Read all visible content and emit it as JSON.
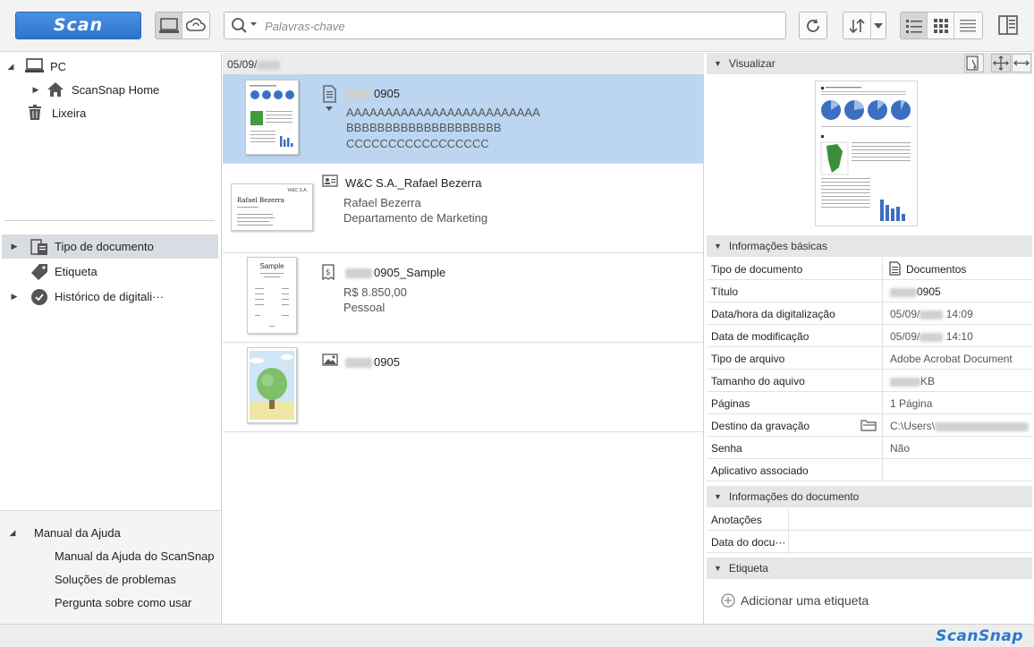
{
  "toolbar": {
    "scan_label": "Scan",
    "search_placeholder": "Palavras-chave",
    "icons": [
      "computer-icon",
      "cloud-sync-icon",
      "search-icon",
      "refresh-icon",
      "sort-icon",
      "list-view-icon",
      "grid-view-icon",
      "detail-view-icon",
      "panel-toggle-icon"
    ]
  },
  "sidebar": {
    "tree": {
      "pc": "PC",
      "home": "ScanSnap Home",
      "trash": "Lixeira"
    },
    "categories": [
      {
        "label": "Tipo de documento"
      },
      {
        "label": "Etiqueta"
      },
      {
        "label": "Histórico de digitali···"
      }
    ],
    "help": {
      "title": "Manual da Ajuda",
      "items": [
        "Manual da Ajuda do ScanSnap",
        "Soluções de problemas",
        "Pergunta sobre como usar"
      ]
    }
  },
  "list": {
    "date_header": "05/09/",
    "items": [
      {
        "name": "0905",
        "lines": [
          "AAAAAAAAAAAAAAAAAAAAAAAAA",
          "BBBBBBBBBBBBBBBBBBBB",
          "CCCCCCCCCCCCCCCCC"
        ]
      },
      {
        "name": "W&C S.A._Rafael Bezerra",
        "lines": [
          "Rafael Bezerra",
          "Departamento de Marketing"
        ],
        "card_title": "Rafael Bezerra",
        "card_corner": "W&C S.A."
      },
      {
        "name": "0905_Sample",
        "lines": [
          "R$ 8.850,00",
          "Pessoal"
        ],
        "receipt_title": "Sample"
      },
      {
        "name": "0905",
        "lines": []
      }
    ]
  },
  "details": {
    "preview_title": "Visualizar",
    "basic_title": "Informações básicas",
    "basic": [
      {
        "key": "Tipo de documento",
        "value": "Documentos"
      },
      {
        "key": "Título",
        "value": "0905"
      },
      {
        "key": "Data/hora da digitalização",
        "value_pre": "05/09/",
        "value_post": "14:09"
      },
      {
        "key": "Data de modificação",
        "value_pre": "05/09/",
        "value_post": "14:10"
      },
      {
        "key": "Tipo de arquivo",
        "value": "Adobe Acrobat Document"
      },
      {
        "key": "Tamanho do aquivo",
        "value": "KB"
      },
      {
        "key": "Páginas",
        "value": "1 Página"
      },
      {
        "key": "Destino da gravação",
        "value": "C:\\Users\\"
      },
      {
        "key": "Senha",
        "value": "Não"
      },
      {
        "key": "Aplicativo associado",
        "value": ""
      }
    ],
    "doc_info_title": "Informações do documento",
    "doc_info": [
      {
        "key": "Anotações",
        "value": ""
      },
      {
        "key": "Data do docu···",
        "value": ""
      }
    ],
    "tag_title": "Etiqueta",
    "add_tag": "Adicionar uma etiqueta"
  },
  "footer": {
    "brand": "ScanSnap"
  },
  "colors": {
    "accent": "#2f74cc",
    "selection": "#bcd6f1",
    "brand": "#2a78d0"
  }
}
